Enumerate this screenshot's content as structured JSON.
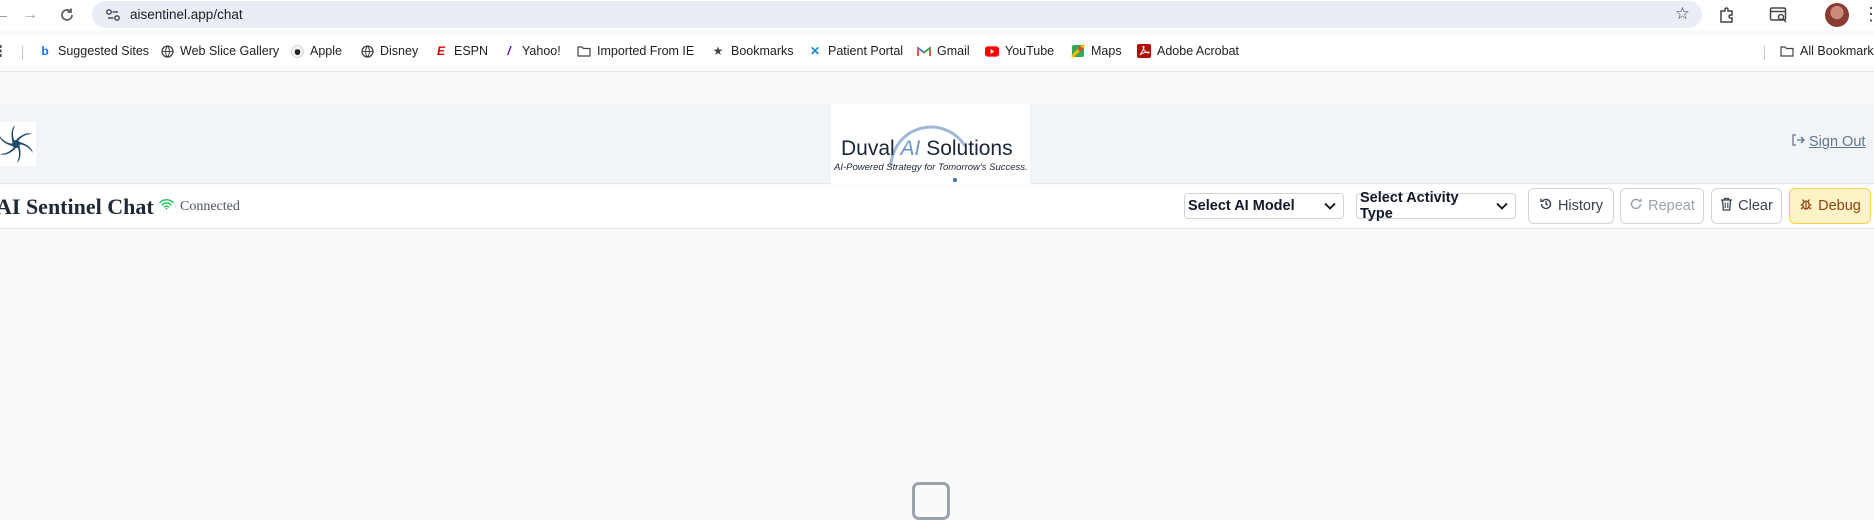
{
  "browser": {
    "url": "aisentinel.app/chat"
  },
  "bookmarks": {
    "items": [
      {
        "label": "Suggested Sites",
        "icon": "bing-icon"
      },
      {
        "label": "Web Slice Gallery",
        "icon": "globe-icon"
      },
      {
        "label": "Apple",
        "icon": "apple-icon"
      },
      {
        "label": "Disney",
        "icon": "globe-icon"
      },
      {
        "label": "ESPN",
        "icon": "espn-icon"
      },
      {
        "label": "Yahoo!",
        "icon": "yahoo-icon"
      },
      {
        "label": "Imported From IE",
        "icon": "folder-icon"
      },
      {
        "label": "Bookmarks",
        "icon": "star-icon"
      },
      {
        "label": "Patient Portal",
        "icon": "x-logo-icon"
      },
      {
        "label": "Gmail",
        "icon": "gmail-icon"
      },
      {
        "label": "YouTube",
        "icon": "youtube-icon"
      },
      {
        "label": "Maps",
        "icon": "maps-icon"
      },
      {
        "label": "Adobe Acrobat",
        "icon": "acrobat-icon"
      }
    ],
    "all_bookmarks": "All Bookmarks"
  },
  "header": {
    "brand_name_start": "Duval ",
    "brand_name_ai": "AI",
    "brand_name_end": " Solutions",
    "brand_tagline": "AI-Powered Strategy for Tomorrow's Success.",
    "sign_out": "Sign Out"
  },
  "chat": {
    "title": "AI Sentinel Chat",
    "status": "Connected",
    "model_select": "Select AI Model",
    "activity_select": "Select Activity Type",
    "buttons": {
      "history": "History",
      "repeat": "Repeat",
      "clear": "Clear",
      "debug": "Debug"
    }
  },
  "colors": {
    "accent_blue": "#6b96c7",
    "connected_green": "#22c55e",
    "debug_bg": "#fef3c7",
    "debug_text": "#92400e"
  }
}
